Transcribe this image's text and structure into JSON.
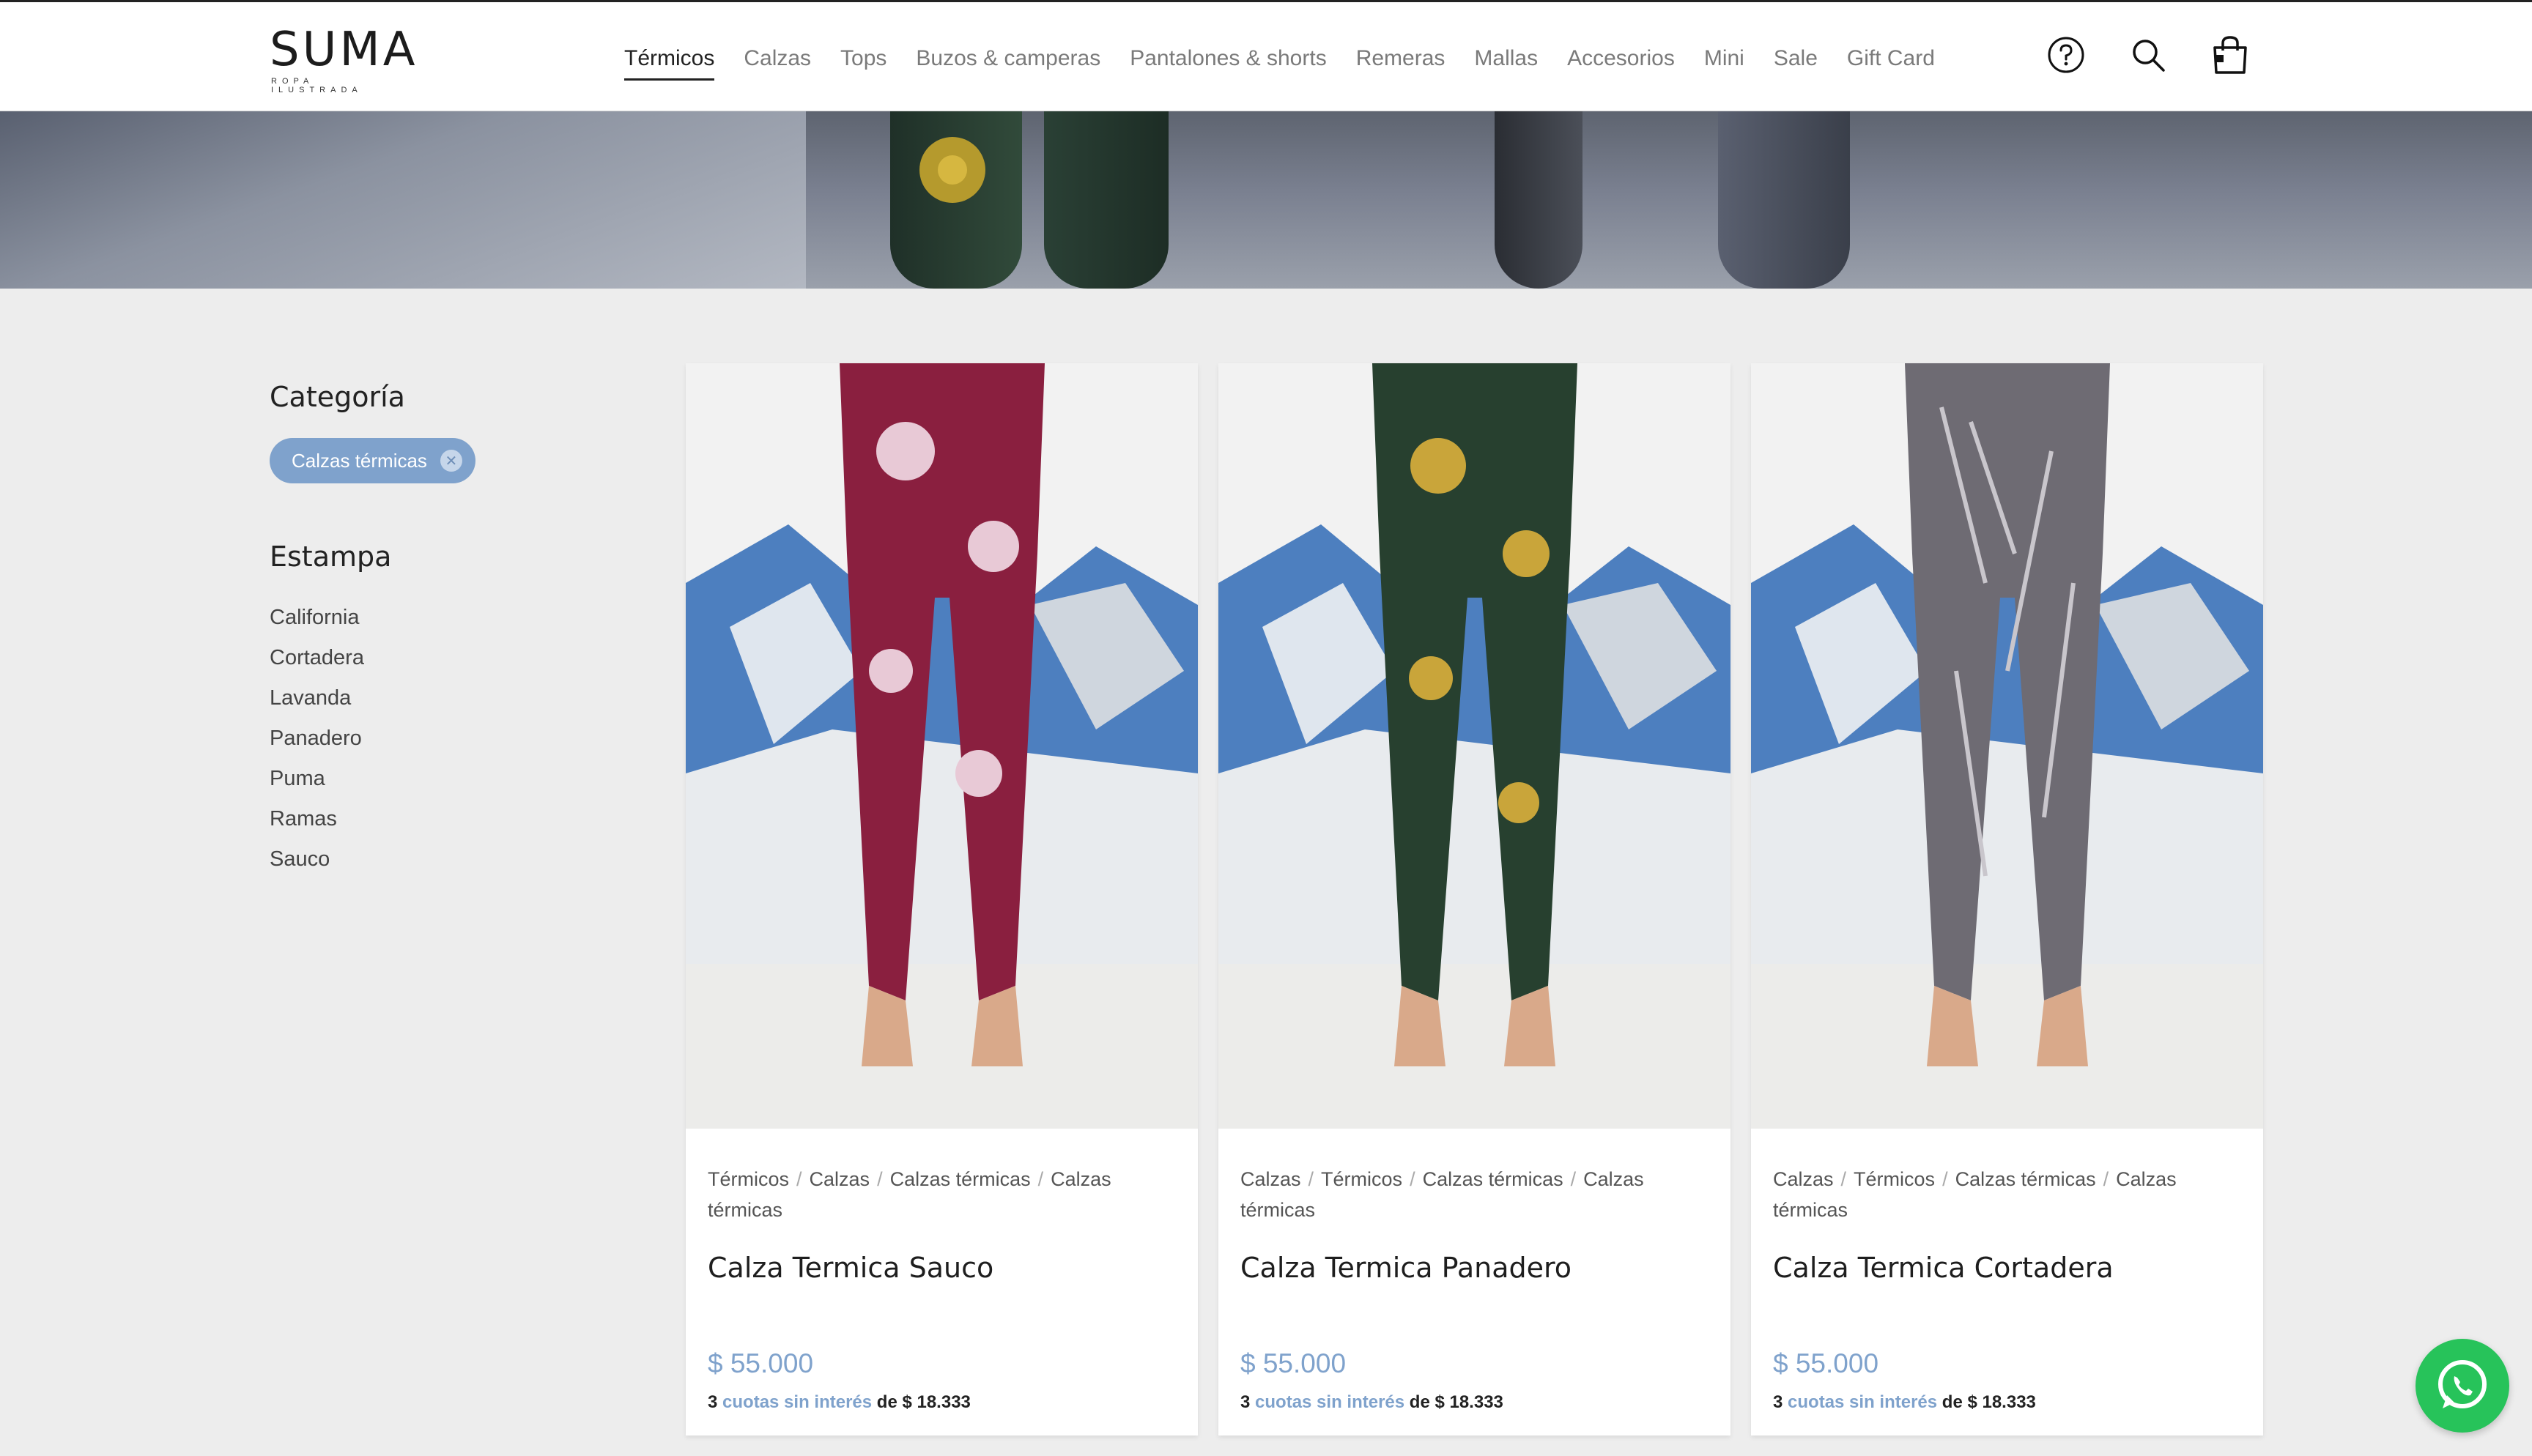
{
  "header": {
    "logo": {
      "name": "SUMA",
      "tagline": "ROPA ILUSTRADA"
    },
    "nav": [
      {
        "label": "Térmicos",
        "active": true
      },
      {
        "label": "Calzas"
      },
      {
        "label": "Tops"
      },
      {
        "label": "Buzos & camperas"
      },
      {
        "label": "Pantalones & shorts"
      },
      {
        "label": "Remeras"
      },
      {
        "label": "Mallas"
      },
      {
        "label": "Accesorios"
      },
      {
        "label": "Mini"
      },
      {
        "label": "Sale"
      },
      {
        "label": "Gift Card"
      }
    ],
    "icons": [
      "help-icon",
      "search-icon",
      "cart-icon"
    ]
  },
  "sidebar": {
    "category_title": "Categoría",
    "active_filter": "Calzas térmicas",
    "estampa_title": "Estampa",
    "estampas": [
      "California",
      "Cortadera",
      "Lavanda",
      "Panadero",
      "Puma",
      "Ramas",
      "Sauco"
    ]
  },
  "products": [
    {
      "crumbs": [
        "Térmicos",
        "Calzas",
        "Calzas térmicas",
        "Calzas térmicas"
      ],
      "name": "Calza Termica Sauco",
      "price": "$ 55.000",
      "installments_count": "3",
      "installments_text": "cuotas sin interés",
      "installments_de": "de",
      "installments_amount": "$ 18.333",
      "color": "#8a1f3f"
    },
    {
      "crumbs": [
        "Calzas",
        "Térmicos",
        "Calzas térmicas",
        "Calzas térmicas"
      ],
      "name": "Calza Termica Panadero",
      "price": "$ 55.000",
      "installments_count": "3",
      "installments_text": "cuotas sin interés",
      "installments_de": "de",
      "installments_amount": "$ 18.333",
      "color": "#27402f"
    },
    {
      "crumbs": [
        "Calzas",
        "Térmicos",
        "Calzas térmicas",
        "Calzas térmicas"
      ],
      "name": "Calza Termica Cortadera",
      "price": "$ 55.000",
      "installments_count": "3",
      "installments_text": "cuotas sin interés",
      "installments_de": "de",
      "installments_amount": "$ 18.333",
      "color": "#6e6b73"
    }
  ],
  "colors": {
    "accent": "#7fa2cc",
    "whatsapp": "#27c35a"
  },
  "floating": {
    "icon": "whatsapp-icon"
  }
}
